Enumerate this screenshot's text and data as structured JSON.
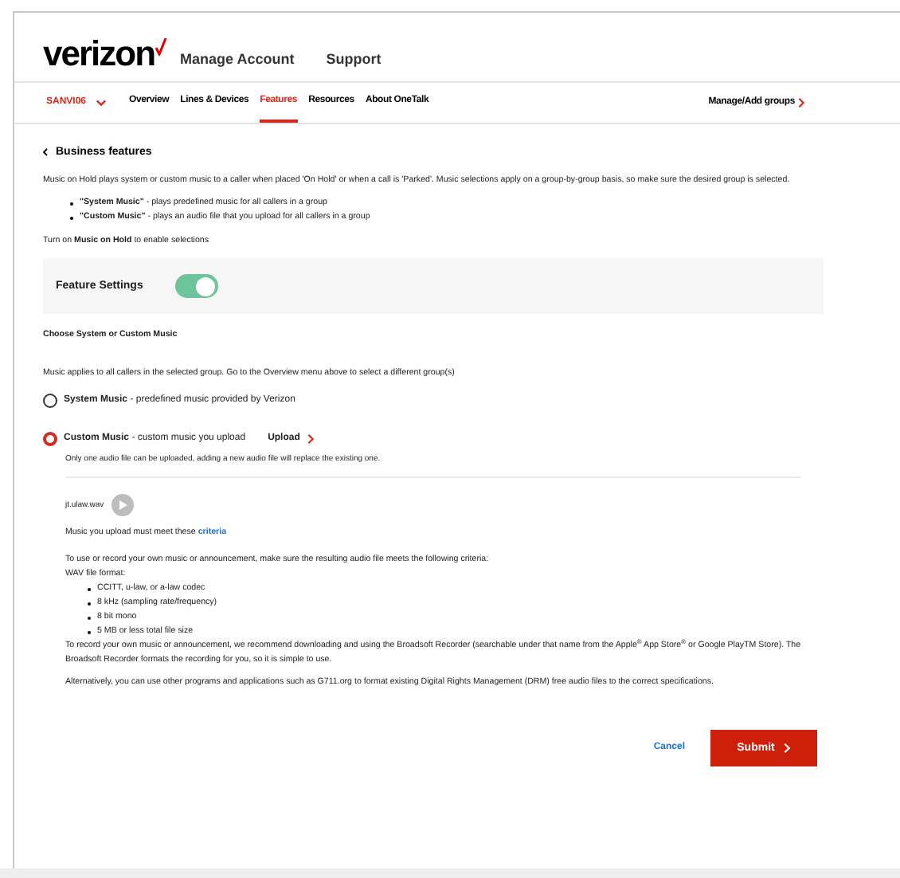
{
  "header": {
    "logo": "verizon",
    "links": [
      "Manage Account",
      "Support"
    ]
  },
  "nav": {
    "group": "SANVI06",
    "items": [
      {
        "label": "Overview",
        "selected": false
      },
      {
        "label": "Lines & Devices",
        "selected": false
      },
      {
        "label": "Features",
        "selected": true
      },
      {
        "label": "Resources",
        "selected": false
      },
      {
        "label": "About OneTalk",
        "selected": false
      }
    ],
    "manage_link": "Manage/Add groups"
  },
  "back_link": "Business features",
  "intro": "Music on Hold plays system or custom music to a caller when placed 'On Hold' or when a call is 'Parked'. Music selections apply on a group-by-group basis, so make sure the desired group is selected.",
  "intro_bullets": [
    "**\"System Music\"** - plays predefined music for all callers in a group",
    "**\"Custom Music\"** - plays an audio file that you upload for all callers in a group"
  ],
  "turn_on": "Turn on **Music on Hold** to enable selections",
  "feature_settings": {
    "label": "Feature Settings",
    "on": true
  },
  "choose_heading": "Choose System or Custom Music",
  "choose_note": "Music applies to all callers in the selected group. Go to the Overview menu above to select a different group(s)",
  "options": [
    {
      "label": "System Music",
      "description": "- predefined music provided by Verizon",
      "selected": false
    },
    {
      "label": "Custom Music",
      "description": "- custom music you upload",
      "selected": true,
      "action": "Upload"
    }
  ],
  "upload_note": "Only one audio file can be uploaded, adding a new audio file will replace the existing one.",
  "file": {
    "name": "jt.ulaw.wav"
  },
  "criteria": {
    "text": "Music you upload must meet these",
    "link": "criteria"
  },
  "requirements": {
    "intro": "To use or record your own music or announcement, make sure the resulting audio file meets the following criteria:",
    "format_label": "WAV file format:",
    "items": [
      "CCITT, u-law, or a-law codec",
      "8 kHz (sampling rate/frequency)",
      "8 bit mono",
      "5 MB or less total file size"
    ],
    "paragraphs": [
      "To record your own music or announcement, we recommend downloading and using the Broadsoft Recorder (searchable under that name from the Apple$^{®}$ App Store$^{®}$ or Google PlayTM Store). The Broadsoft Recorder formats the recording for you, so it is simple to use.",
      "Alternatively, you can use other programs and applications such as G711.org to format existing Digital Rights Management (DRM) free audio files to the correct specifications."
    ]
  },
  "buttons": {
    "cancel": "Cancel",
    "submit": "Submit"
  }
}
